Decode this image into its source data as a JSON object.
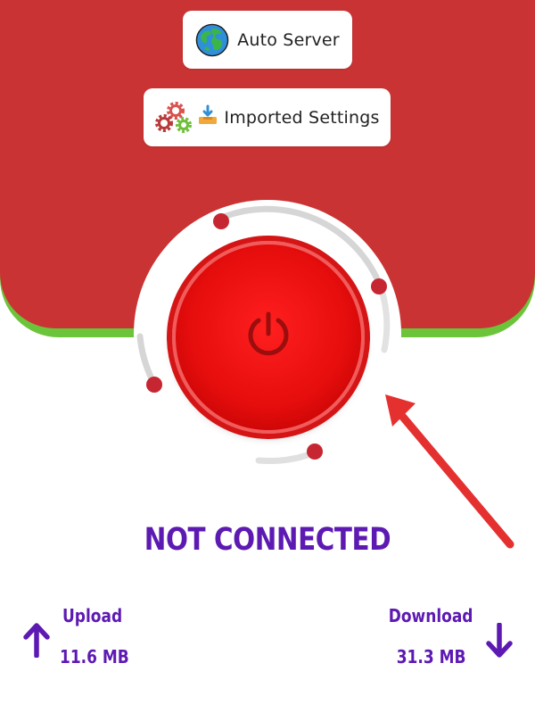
{
  "server": {
    "label": "Auto Server",
    "icon": "globe-icon"
  },
  "settings": {
    "label": "Imported Settings",
    "icons": [
      "gears-icon",
      "tray-download-icon"
    ]
  },
  "connection": {
    "status": "NOT CONNECTED",
    "button_icon": "power-icon"
  },
  "traffic": {
    "upload": {
      "label": "Upload",
      "value": "11.6 MB",
      "icon": "arrow-up-icon"
    },
    "download": {
      "label": "Download",
      "value": "31.3 MB",
      "icon": "arrow-down-icon"
    }
  },
  "colors": {
    "header_red": "#c93333",
    "header_green": "#6cc43a",
    "accent_purple": "#5d1ab3",
    "button_red": "#e60d0d",
    "ring_dot": "#c62632",
    "pointer_arrow": "#e53030"
  }
}
